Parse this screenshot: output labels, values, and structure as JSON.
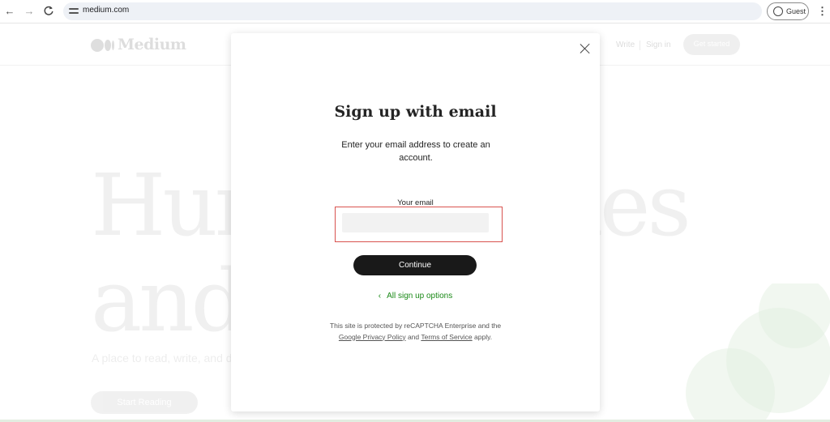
{
  "browser": {
    "url": "medium.com",
    "profile_label": "Guest",
    "nav_back": "←",
    "nav_forward": "→",
    "nav_reload": "C",
    "menu": "⋮"
  },
  "background_page": {
    "logo_text": "Medium",
    "header_write": "Write",
    "header_signin": "Sign in",
    "header_cta": "Get started",
    "hero_line1": "Human stories",
    "hero_line2": "and ideas",
    "hero_sub": "A place to read, write, and deepen your understanding",
    "hero_button": "Start Reading"
  },
  "modal": {
    "title": "Sign up with email",
    "description": "Enter your email address to create an account.",
    "email_label": "Your email",
    "email_value": "",
    "continue_label": "Continue",
    "back_chevron": "‹",
    "back_link": "All sign up options",
    "legal_prefix": "This site is protected by reCAPTCHA Enterprise and the",
    "legal_privacy": "Google Privacy Policy",
    "legal_and": "and",
    "legal_terms": "Terms of Service",
    "legal_suffix": "apply."
  },
  "colors": {
    "link_green": "#1a8917",
    "focus_outline": "#d9534f",
    "button_dark": "#191919"
  }
}
